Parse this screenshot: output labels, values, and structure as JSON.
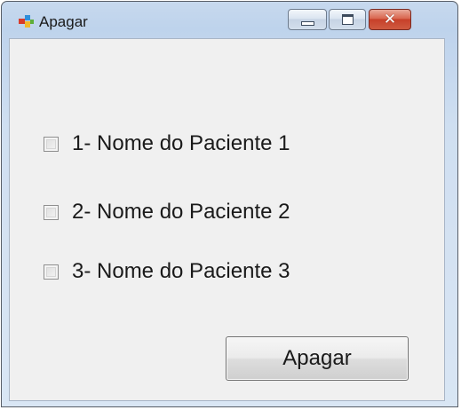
{
  "window": {
    "title": "Apagar",
    "app_icon": "winforms-app-icon",
    "controls": {
      "minimize": "minimize-icon",
      "maximize": "maximize-icon",
      "close": "close-icon"
    }
  },
  "form": {
    "checkboxes": [
      {
        "label": "1- Nome do Paciente 1",
        "checked": false
      },
      {
        "label": "2- Nome do Paciente 2",
        "checked": false
      },
      {
        "label": "3- Nome do Paciente 3",
        "checked": false
      }
    ],
    "button_label": "Apagar"
  },
  "colors": {
    "title_bar": "#c7d9ee",
    "client_background": "#f0f0f0",
    "close_button": "#c7402a"
  }
}
